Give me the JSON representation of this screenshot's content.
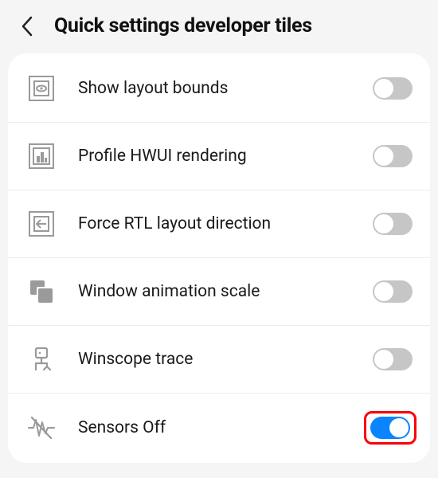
{
  "header": {
    "title": "Quick settings developer tiles"
  },
  "rows": [
    {
      "icon": "layout-bounds-icon",
      "label": "Show layout bounds",
      "on": false,
      "highlight": false
    },
    {
      "icon": "profile-hwui-icon",
      "label": "Profile HWUI rendering",
      "on": false,
      "highlight": false
    },
    {
      "icon": "rtl-layout-icon",
      "label": "Force RTL layout direction",
      "on": false,
      "highlight": false
    },
    {
      "icon": "window-animation-icon",
      "label": "Window animation scale",
      "on": false,
      "highlight": false
    },
    {
      "icon": "winscope-trace-icon",
      "label": "Winscope trace",
      "on": false,
      "highlight": false
    },
    {
      "icon": "sensors-off-icon",
      "label": "Sensors Off",
      "on": true,
      "highlight": true
    }
  ],
  "colors": {
    "accent": "#0a84ff",
    "highlight": "#fb0007"
  }
}
